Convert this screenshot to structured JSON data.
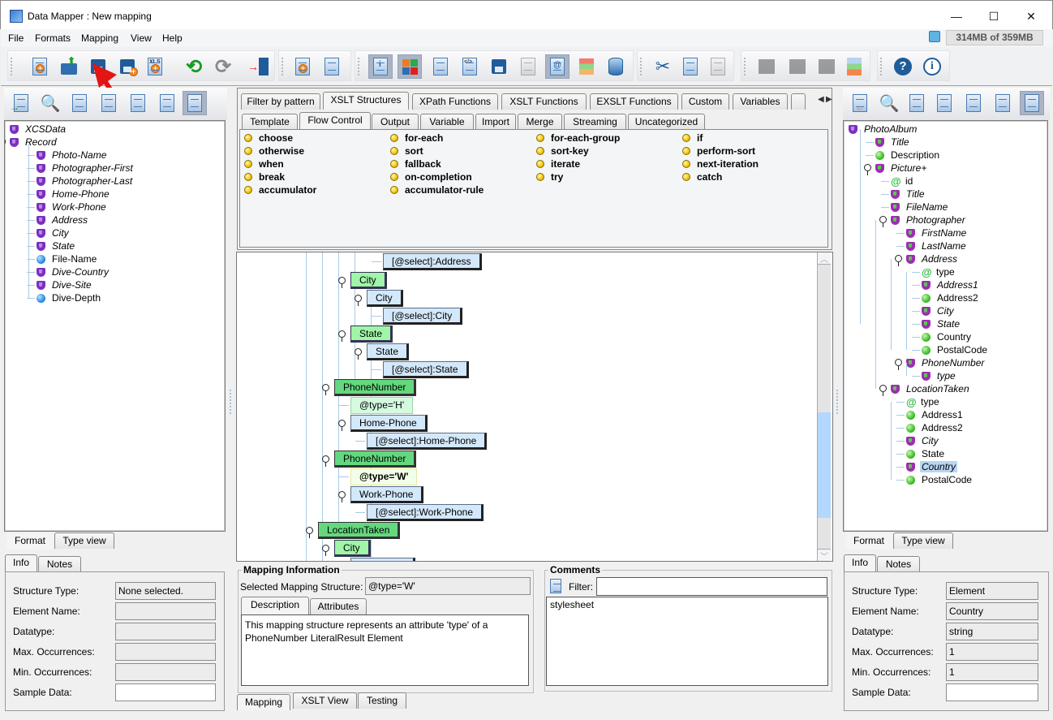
{
  "window": {
    "title": "Data Mapper : New mapping",
    "controls": {
      "minimize": "—",
      "maximize": "☐",
      "close": "✕"
    }
  },
  "menu": {
    "items": [
      {
        "label": "File",
        "mnemonic": "F"
      },
      {
        "label": "Formats",
        "mnemonic": "o"
      },
      {
        "label": "Mapping",
        "mnemonic": "M"
      },
      {
        "label": "View",
        "mnemonic": "V"
      },
      {
        "label": "Help",
        "mnemonic": "H"
      }
    ],
    "memory": "314MB of 359MB"
  },
  "toolbar": {
    "groups": [
      [
        "new-mapping",
        "open",
        "save",
        "save-as",
        "export-xls",
        "undo",
        "redo",
        "exit"
      ],
      [
        "new-structure",
        "structure-settings"
      ],
      [
        "view-info",
        "view-colors",
        "validate",
        "xslt-source",
        "save-output",
        "wsdl",
        "at-symbol",
        "type-editor",
        "database"
      ],
      [
        "cut",
        "copy",
        "paste"
      ],
      [
        "move-up",
        "move-between",
        "move-down",
        "layout-colors"
      ],
      [
        "help",
        "about"
      ]
    ]
  },
  "source_panel": {
    "tree": [
      {
        "label": "XCSData",
        "icon": "element",
        "italic": true,
        "depth": 0
      },
      {
        "label": "Record",
        "icon": "element",
        "italic": true,
        "depth": 0,
        "expandable": true
      },
      {
        "label": "Photo-Name",
        "icon": "element",
        "italic": true,
        "depth": 1
      },
      {
        "label": "Photographer-First",
        "icon": "element",
        "italic": true,
        "depth": 1
      },
      {
        "label": "Photographer-Last",
        "icon": "element",
        "italic": true,
        "depth": 1
      },
      {
        "label": "Home-Phone",
        "icon": "element",
        "italic": true,
        "depth": 1
      },
      {
        "label": "Work-Phone",
        "icon": "element",
        "italic": true,
        "depth": 1
      },
      {
        "label": "Address",
        "icon": "element",
        "italic": true,
        "depth": 1
      },
      {
        "label": "City",
        "icon": "element",
        "italic": true,
        "depth": 1
      },
      {
        "label": "State",
        "icon": "element",
        "italic": true,
        "depth": 1
      },
      {
        "label": "File-Name",
        "icon": "blue-ball",
        "italic": false,
        "depth": 1
      },
      {
        "label": "Dive-Country",
        "icon": "element",
        "italic": true,
        "depth": 1
      },
      {
        "label": "Dive-Site",
        "icon": "element",
        "italic": true,
        "depth": 1
      },
      {
        "label": "Dive-Depth",
        "icon": "blue-ball",
        "italic": false,
        "depth": 1
      }
    ],
    "view_tabs": [
      "Format",
      "Type view"
    ],
    "info_tabs": [
      "Info",
      "Notes"
    ],
    "info": {
      "labels": [
        "Structure Type:",
        "Element Name:",
        "Datatype:",
        "Max. Occurrences:",
        "Min. Occurrences:",
        "Sample Data:"
      ],
      "values": [
        "None selected.",
        "",
        "",
        "",
        "",
        ""
      ]
    }
  },
  "palette": {
    "tabs": [
      "Filter by pattern",
      "XSLT Structures",
      "XPath Functions",
      "XSLT Functions",
      "EXSLT Functions",
      "Custom",
      "Variables"
    ],
    "selected_tab": "XSLT Structures",
    "subtabs": [
      "Template",
      "Flow Control",
      "Output",
      "Variable",
      "Import",
      "Merge",
      "Streaming",
      "Uncategorized"
    ],
    "selected_subtab": "Flow Control",
    "columns": [
      [
        "choose",
        "otherwise",
        "when",
        "break",
        "accumulator"
      ],
      [
        "for-each",
        "sort",
        "fallback",
        "on-completion",
        "accumulator-rule"
      ],
      [
        "for-each-group",
        "sort-key",
        "iterate",
        "try"
      ],
      [
        "if",
        "perform-sort",
        "next-iteration",
        "catch"
      ]
    ]
  },
  "mapping_canvas": {
    "nodes": [
      {
        "label": "[@select]:Address",
        "kind": "select"
      },
      {
        "label": "City",
        "kind": "element-light"
      },
      {
        "label": "City",
        "kind": "source"
      },
      {
        "label": "[@select]:City",
        "kind": "select"
      },
      {
        "label": "State",
        "kind": "element-light"
      },
      {
        "label": "State",
        "kind": "source"
      },
      {
        "label": "[@select]:State",
        "kind": "select"
      },
      {
        "label": "PhoneNumber",
        "kind": "element-dark"
      },
      {
        "label": "@type='H'",
        "kind": "attribute"
      },
      {
        "label": "Home-Phone",
        "kind": "source"
      },
      {
        "label": "[@select]:Home-Phone",
        "kind": "select"
      },
      {
        "label": "PhoneNumber",
        "kind": "element-dark"
      },
      {
        "label": "@type='W'",
        "kind": "attribute-selected"
      },
      {
        "label": "Work-Phone",
        "kind": "source"
      },
      {
        "label": "[@select]:Work-Phone",
        "kind": "select"
      },
      {
        "label": "LocationTaken",
        "kind": "element-dark"
      },
      {
        "label": "City",
        "kind": "element-light"
      }
    ]
  },
  "mapping_info": {
    "title": "Mapping Information",
    "selected_label": "Selected Mapping Structure:",
    "selected_value": "@type='W'",
    "tabs": [
      "Description",
      "Attributes"
    ],
    "description": "This mapping structure represents an attribute 'type' of a PhoneNumber LiteralResult Element"
  },
  "comments": {
    "title": "Comments",
    "filter_label": "Filter:",
    "filter_value": "",
    "items": [
      "stylesheet"
    ]
  },
  "center_bottom_tabs": [
    "Mapping",
    "XSLT View",
    "Testing"
  ],
  "target_panel": {
    "tree": [
      {
        "label": "PhotoAlbum",
        "icon": "element",
        "italic": true,
        "depth": 0
      },
      {
        "label": "Title",
        "icon": "element",
        "italic": true,
        "depth": 1
      },
      {
        "label": "Description",
        "icon": "green-ball",
        "italic": false,
        "depth": 1
      },
      {
        "label": "Picture+",
        "icon": "element",
        "italic": true,
        "depth": 1,
        "expandable": true
      },
      {
        "label": "id",
        "icon": "attribute",
        "italic": false,
        "depth": 2
      },
      {
        "label": "Title",
        "icon": "element",
        "italic": true,
        "depth": 2
      },
      {
        "label": "FileName",
        "icon": "element",
        "italic": true,
        "depth": 2
      },
      {
        "label": "Photographer",
        "icon": "element",
        "italic": true,
        "depth": 2,
        "expandable": true
      },
      {
        "label": "FirstName",
        "icon": "element",
        "italic": true,
        "depth": 3
      },
      {
        "label": "LastName",
        "icon": "element",
        "italic": true,
        "depth": 3
      },
      {
        "label": "Address",
        "icon": "element",
        "italic": true,
        "depth": 3,
        "expandable": true
      },
      {
        "label": "type",
        "icon": "attribute",
        "italic": false,
        "depth": 4
      },
      {
        "label": "Address1",
        "icon": "element",
        "italic": true,
        "depth": 4
      },
      {
        "label": "Address2",
        "icon": "green-ball",
        "italic": false,
        "depth": 4
      },
      {
        "label": "City",
        "icon": "element",
        "italic": true,
        "depth": 4
      },
      {
        "label": "State",
        "icon": "element",
        "italic": true,
        "depth": 4
      },
      {
        "label": "Country",
        "icon": "green-ball",
        "italic": false,
        "depth": 4
      },
      {
        "label": "PostalCode",
        "icon": "green-ball",
        "italic": false,
        "depth": 4
      },
      {
        "label": "PhoneNumber",
        "icon": "element",
        "italic": true,
        "depth": 3,
        "expandable": true
      },
      {
        "label": "type",
        "icon": "mapped-attribute",
        "italic": true,
        "depth": 4
      },
      {
        "label": "LocationTaken",
        "icon": "element",
        "italic": true,
        "depth": 2,
        "expandable": true
      },
      {
        "label": "type",
        "icon": "attribute",
        "italic": false,
        "depth": 3
      },
      {
        "label": "Address1",
        "icon": "green-ball",
        "italic": false,
        "depth": 3
      },
      {
        "label": "Address2",
        "icon": "green-ball",
        "italic": false,
        "depth": 3
      },
      {
        "label": "City",
        "icon": "element",
        "italic": true,
        "depth": 3
      },
      {
        "label": "State",
        "icon": "green-ball",
        "italic": false,
        "depth": 3
      },
      {
        "label": "Country",
        "icon": "element",
        "italic": true,
        "depth": 3,
        "selected": true
      },
      {
        "label": "PostalCode",
        "icon": "green-ball",
        "italic": false,
        "depth": 3
      }
    ],
    "view_tabs": [
      "Format",
      "Type view"
    ],
    "info_tabs": [
      "Info",
      "Notes"
    ],
    "info": {
      "labels": [
        "Structure Type:",
        "Element Name:",
        "Datatype:",
        "Max. Occurrences:",
        "Min. Occurrences:",
        "Sample Data:"
      ],
      "values": [
        "Element",
        "Country",
        "string",
        "1",
        "1",
        ""
      ]
    }
  },
  "colors": {
    "selection": "#b8d6f5",
    "element_light": "#a0f5a8",
    "element_dark": "#64d87e",
    "source_box": "#d4e8fb",
    "scroll_thumb": "#b3d7ff"
  }
}
